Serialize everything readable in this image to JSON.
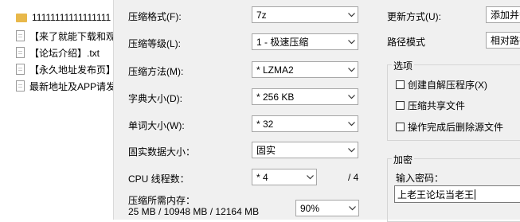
{
  "files": [
    {
      "name": "11111111111111111",
      "icon": "folder-icon"
    },
    {
      "name": "【来了就能下载和观",
      "icon": "text-file-icon"
    },
    {
      "name": "【论坛介绍】.txt",
      "icon": "text-file-icon"
    },
    {
      "name": "【永久地址发布页】",
      "icon": "text-file-icon"
    },
    {
      "name": "最新地址及APP请发",
      "icon": "text-file-icon"
    }
  ],
  "dialog": {
    "format_label": "压缩格式(F):",
    "format_value": "7z",
    "level_label": "压缩等级(L):",
    "level_value": "1 - 极速压缩",
    "method_label": "压缩方法(M):",
    "method_value": "* LZMA2",
    "dict_label": "字典大小(D):",
    "dict_value": "* 256 KB",
    "word_label": "单词大小(W):",
    "word_value": "* 32",
    "solid_label": "固实数据大小：",
    "solid_value": "固实",
    "cpu_label": "CPU 线程数：",
    "cpu_value": "* 4",
    "cpu_total": "/ 4",
    "memory_label": "压缩所需内存：",
    "memory_value": "25 MB / 10948 MB / 12164 MB",
    "memory_percent": "90%",
    "update_label": "更新方式(U):",
    "update_value": "添加并替",
    "path_label": "路径模式",
    "path_value": "相对路径",
    "options_title": "选项",
    "opt_sfx": "创建自解压程序(X)",
    "opt_shared": "压缩共享文件",
    "opt_delete": "操作完成后删除源文件",
    "encrypt_title": "加密",
    "password_label": "输入密码：",
    "password_value": "上老王论坛当老王"
  },
  "colors": {
    "dialog_bg": "#f0f0f0",
    "folder": "#e8b84a"
  }
}
